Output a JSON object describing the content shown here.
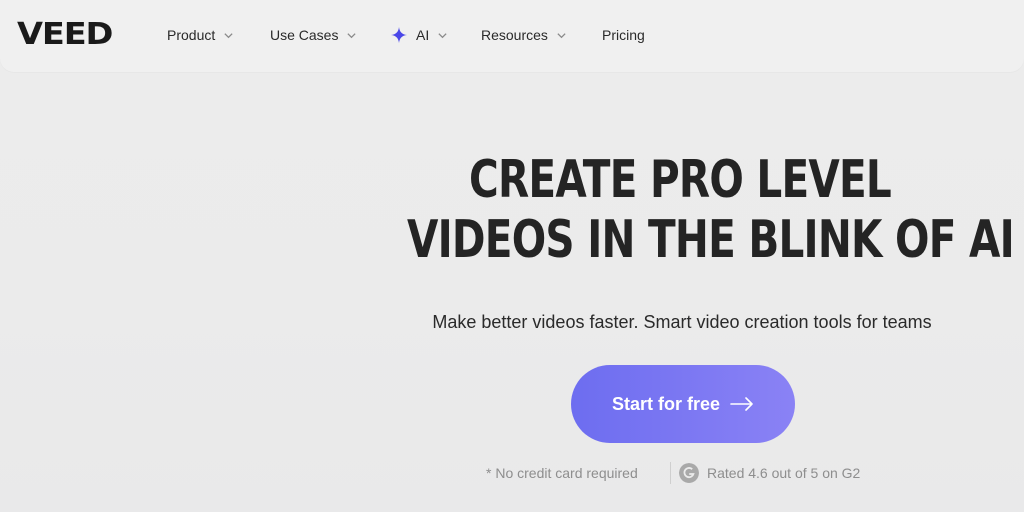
{
  "nav": {
    "logo": "VEED",
    "items": [
      {
        "label": "Product",
        "has_dropdown": true
      },
      {
        "label": "Use Cases",
        "has_dropdown": true
      },
      {
        "label": "AI",
        "has_dropdown": true,
        "icon": "sparkle-icon"
      },
      {
        "label": "Resources",
        "has_dropdown": true
      },
      {
        "label": "Pricing",
        "has_dropdown": false
      }
    ]
  },
  "hero": {
    "title_line1": "CREATE PRO LEVEL",
    "title_line2": "VIDEOS IN THE BLINK OF AI",
    "subtitle": "Make better videos faster. Smart video creation tools for teams",
    "cta_label": "Start for free",
    "note_credit": "* No credit card required",
    "note_rating": "Rated 4.6 out of 5 on G2"
  },
  "colors": {
    "background": "#ebebeb",
    "cta_gradient_start": "#6d6df0",
    "cta_gradient_end": "#8a82f5",
    "sparkle": "#4a47e8",
    "text_dark": "#1b1b1b",
    "text_muted": "#8e8e8e"
  }
}
